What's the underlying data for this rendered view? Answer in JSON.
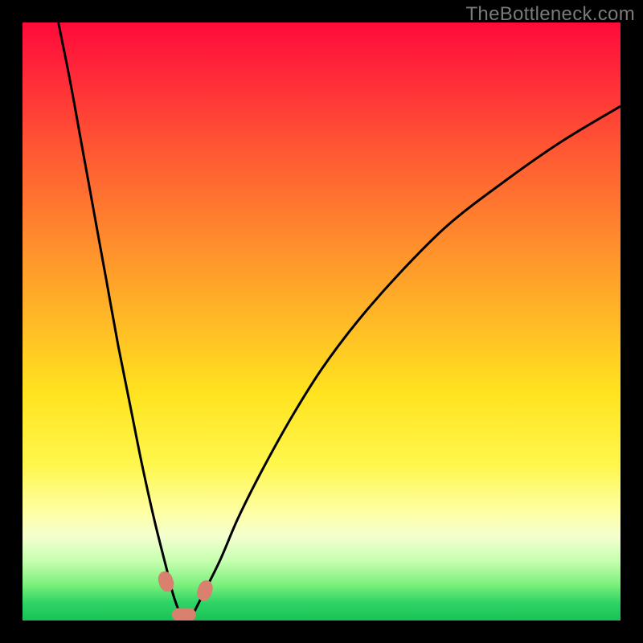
{
  "watermark": "TheBottleneck.com",
  "colors": {
    "background_outer": "#000000",
    "gradient_top": "#ff0a3a",
    "gradient_bottom": "#18c257",
    "curve_stroke": "#000000",
    "marker_fill": "#d9806f",
    "watermark_text": "#7a7a7a"
  },
  "chart_data": {
    "type": "line",
    "title": "",
    "xlabel": "",
    "ylabel": "",
    "xlim": [
      0,
      100
    ],
    "ylim": [
      0,
      100
    ],
    "grid": false,
    "legend": false,
    "note": "Axes are unlabeled; values are pixel-fraction positions (0–100) estimated from the image. Two black curves descend toward a common minimum near x≈27 at the bottom (y≈0). The background maps y to a red→green gradient (red high, green low).",
    "series": [
      {
        "name": "left-curve",
        "x": [
          6,
          8,
          10,
          12,
          14,
          16,
          18,
          20,
          22,
          24,
          25,
          26,
          27
        ],
        "y": [
          100,
          90,
          79,
          68,
          57,
          46,
          36,
          26,
          17,
          9,
          5,
          2,
          0
        ]
      },
      {
        "name": "right-curve",
        "x": [
          28,
          30,
          33,
          36,
          40,
          45,
          50,
          56,
          63,
          71,
          80,
          90,
          100
        ],
        "y": [
          0,
          4,
          10,
          17,
          25,
          34,
          42,
          50,
          58,
          66,
          73,
          80,
          86
        ]
      }
    ],
    "markers": [
      {
        "name": "left-marker",
        "x": 24.0,
        "y": 6.5
      },
      {
        "name": "bottom-marker",
        "x": 27.0,
        "y": 1.0
      },
      {
        "name": "right-marker",
        "x": 30.5,
        "y": 5.0
      }
    ]
  }
}
